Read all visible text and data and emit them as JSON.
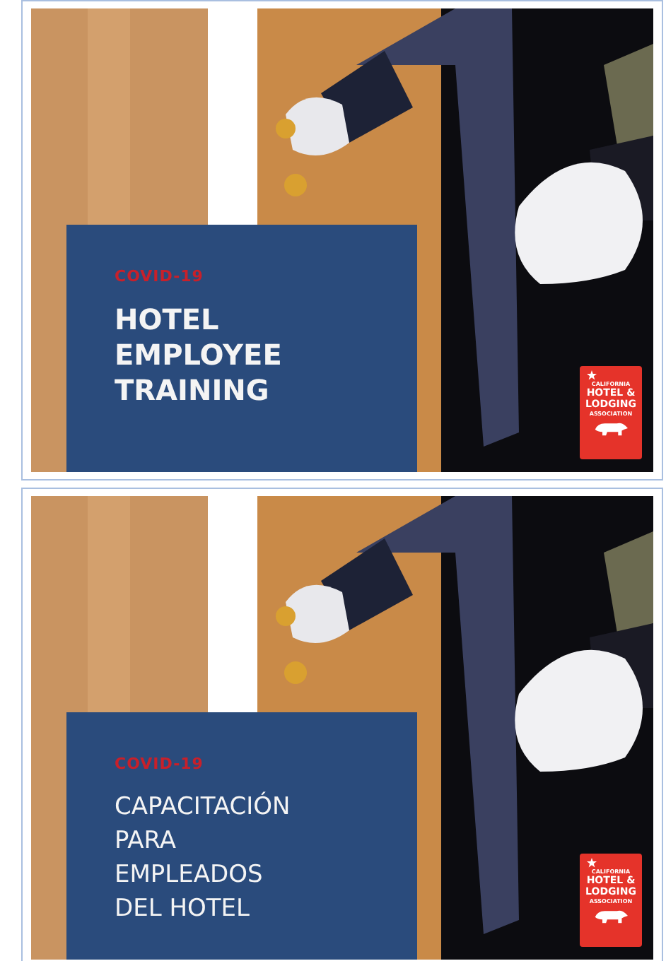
{
  "covers": [
    {
      "kicker": "COVID-19",
      "title_lines": [
        "HOTEL",
        "EMPLOYEE",
        "TRAINING"
      ],
      "title_bold": true,
      "logo_lines": [
        "CALIFORNIA",
        "HOTEL &",
        "LODGING",
        "ASSOCIATION"
      ]
    },
    {
      "kicker": "COVID-19",
      "title_lines": [
        "CAPACITACIÓN",
        "PARA",
        "EMPLEADOS",
        "DEL HOTEL"
      ],
      "title_bold": false,
      "logo_lines": [
        "CALIFORNIA",
        "HOTEL &",
        "LODGING",
        "ASSOCIATION"
      ]
    }
  ]
}
